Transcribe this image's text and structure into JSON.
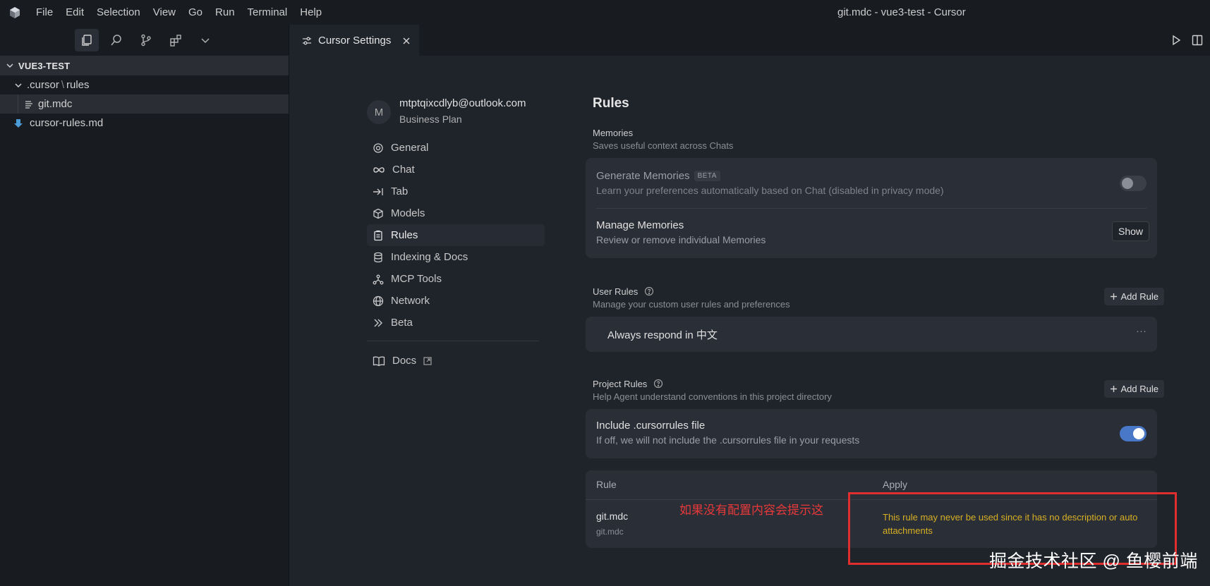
{
  "titlebar": {
    "menu": [
      "File",
      "Edit",
      "Selection",
      "View",
      "Go",
      "Run",
      "Terminal",
      "Help"
    ],
    "window_title": "git.mdc - vue3-test - Cursor"
  },
  "explorer": {
    "root": "VUE3-TEST",
    "folder_label_a": ".cursor",
    "folder_label_b": "rules",
    "files": [
      "git.mdc",
      "cursor-rules.md"
    ]
  },
  "tab": {
    "label": "Cursor Settings"
  },
  "account": {
    "avatar_letter": "M",
    "email": "mtptqixcdlyb@outlook.com",
    "plan": "Business Plan"
  },
  "nav": {
    "items": [
      "General",
      "Chat",
      "Tab",
      "Models",
      "Rules",
      "Indexing & Docs",
      "MCP Tools",
      "Network",
      "Beta"
    ],
    "active": "Rules",
    "docs": "Docs"
  },
  "content": {
    "title": "Rules",
    "memories": {
      "title": "Memories",
      "subtitle": "Saves useful context across Chats",
      "generate_title": "Generate Memories",
      "generate_badge": "BETA",
      "generate_sub": "Learn your preferences automatically based on Chat (disabled in privacy mode)",
      "generate_enabled": false,
      "manage_title": "Manage Memories",
      "manage_sub": "Review or remove individual Memories",
      "manage_button": "Show"
    },
    "user_rules": {
      "title": "User Rules",
      "subtitle": "Manage your custom user rules and preferences",
      "add_button": "Add Rule",
      "rule_text": "Always respond in 中文",
      "more": "···"
    },
    "project_rules": {
      "title": "Project Rules",
      "subtitle": "Help Agent understand conventions in this project directory",
      "add_button": "Add Rule",
      "include_title": "Include .cursorrules file",
      "include_sub": "If off, we will not include the .cursorrules file in your requests",
      "include_enabled": true,
      "table": {
        "col_rule": "Rule",
        "col_apply": "Apply",
        "row_name": "git.mdc",
        "row_path": "git.mdc",
        "row_warning": "This rule may never be used since it has no description or auto attachments"
      }
    }
  },
  "annotation": {
    "text": "如果没有配置内容会提示这",
    "color": "#e8393a"
  },
  "watermark": "掘金技术社区 @ 鱼樱前端"
}
